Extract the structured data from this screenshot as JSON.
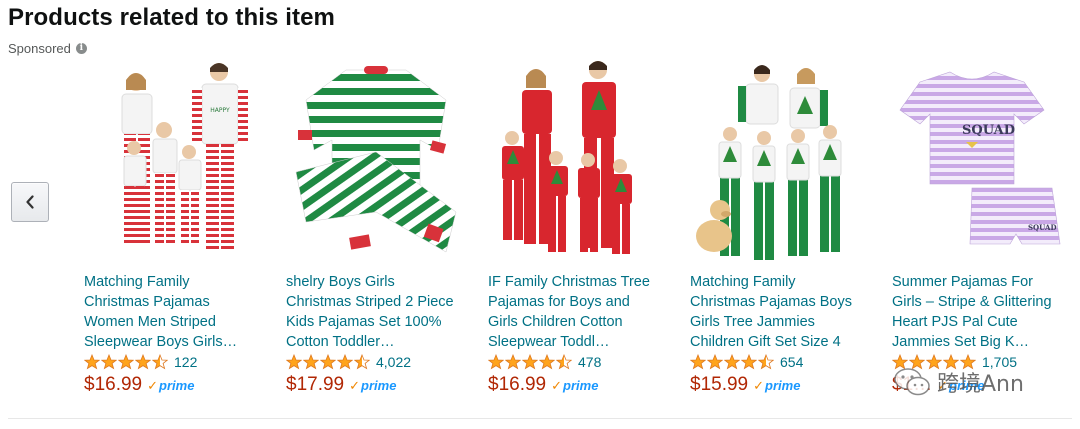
{
  "heading": "Products related to this item",
  "sponsored_label": "Sponsored",
  "info_icon": "i",
  "prime_label": "prime",
  "products": [
    {
      "title": "Matching Family Christmas Pajamas Women Men Striped Sleepwear Boys Girls…",
      "rating": 4.5,
      "reviews": "122",
      "price": "$16.99",
      "image": "family-striped-christmas-pajamas"
    },
    {
      "title": "shelry Boys Girls Christmas Striped 2 Piece Kids Pajamas Set 100% Cotton Toddler…",
      "rating": 4.5,
      "reviews": "4,022",
      "price": "$17.99",
      "image": "green-white-striped-pajama-set"
    },
    {
      "title": "IF Family Christmas Tree Pajamas for Boys and Girls Children Cotton Sleepwear Toddl…",
      "rating": 4.5,
      "reviews": "478",
      "price": "$16.99",
      "image": "family-red-christmas-tree-pajamas"
    },
    {
      "title": "Matching Family Christmas Pajamas Boys Girls Tree Jammies Children Gift Set Size 4",
      "rating": 4.5,
      "reviews": "654",
      "price": "$15.99",
      "image": "family-green-christmas-tree-pajamas"
    },
    {
      "title": "Summer Pajamas For Girls – Stripe & Glittering Heart PJS Pal Cute Jammies Set Big K…",
      "rating": 5,
      "reviews": "1,705",
      "price": "$1…",
      "image": "purple-striped-summer-pajamas"
    }
  ],
  "watermark_text": "跨境Ann",
  "colors": {
    "link": "#007185",
    "price": "#b12704",
    "star": "#ffa41c",
    "prime": "#1a98ff"
  }
}
